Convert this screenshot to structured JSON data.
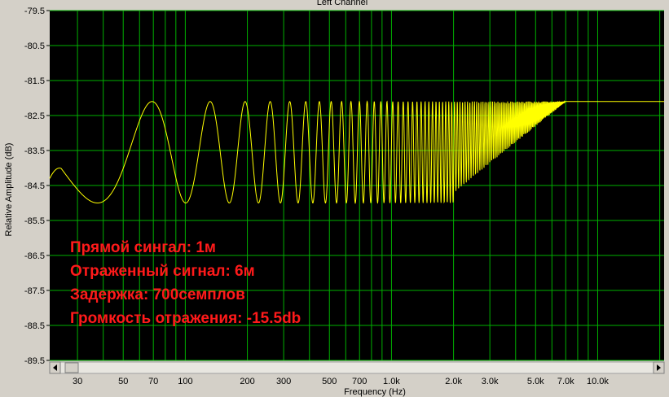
{
  "chart_data": {
    "type": "line",
    "title": "Left Channel",
    "xlabel": "Frequency (Hz)",
    "ylabel": "Relative Amplitude (dB)",
    "x_scale": "log",
    "xlim": [
      22,
      21000
    ],
    "ylim": [
      -89.5,
      -79.5
    ],
    "y_ticks": [
      -79.5,
      -80.5,
      -81.5,
      -82.5,
      -83.5,
      -84.5,
      -85.5,
      -86.5,
      -87.5,
      -88.5,
      -89.5
    ],
    "x_ticks": [
      {
        "value": 30,
        "label": "30"
      },
      {
        "value": 50,
        "label": "50"
      },
      {
        "value": 70,
        "label": "70"
      },
      {
        "value": 100,
        "label": "100"
      },
      {
        "value": 200,
        "label": "200"
      },
      {
        "value": 300,
        "label": "300"
      },
      {
        "value": 500,
        "label": "500"
      },
      {
        "value": 700,
        "label": "700"
      },
      {
        "value": 1000,
        "label": "1.0k"
      },
      {
        "value": 2000,
        "label": "2.0k"
      },
      {
        "value": 3000,
        "label": "3.0k"
      },
      {
        "value": 5000,
        "label": "5.0k"
      },
      {
        "value": 7000,
        "label": "7.0k"
      },
      {
        "value": 10000,
        "label": "10.0k"
      }
    ],
    "grid": true,
    "series": [
      {
        "comb_peak_db": -82.1,
        "comb_notch_db": -85.0,
        "comb_period_hz": 63,
        "first_peak_hz": 69,
        "flat_above_hz": 7000,
        "flat_level_db": -82.1,
        "start_value_db": -84.3
      }
    ],
    "annotations": [
      "Прямой сингал: 1м",
      "Отраженный сигнал: 6м",
      "Задержка: 700семплов",
      "Громкость отражения: -15.5db"
    ]
  },
  "colors": {
    "background": "#d4d0c8",
    "plot_background": "#000000",
    "grid": "#00b000",
    "line": "#ffff00",
    "annotation": "#ff1a1a"
  }
}
